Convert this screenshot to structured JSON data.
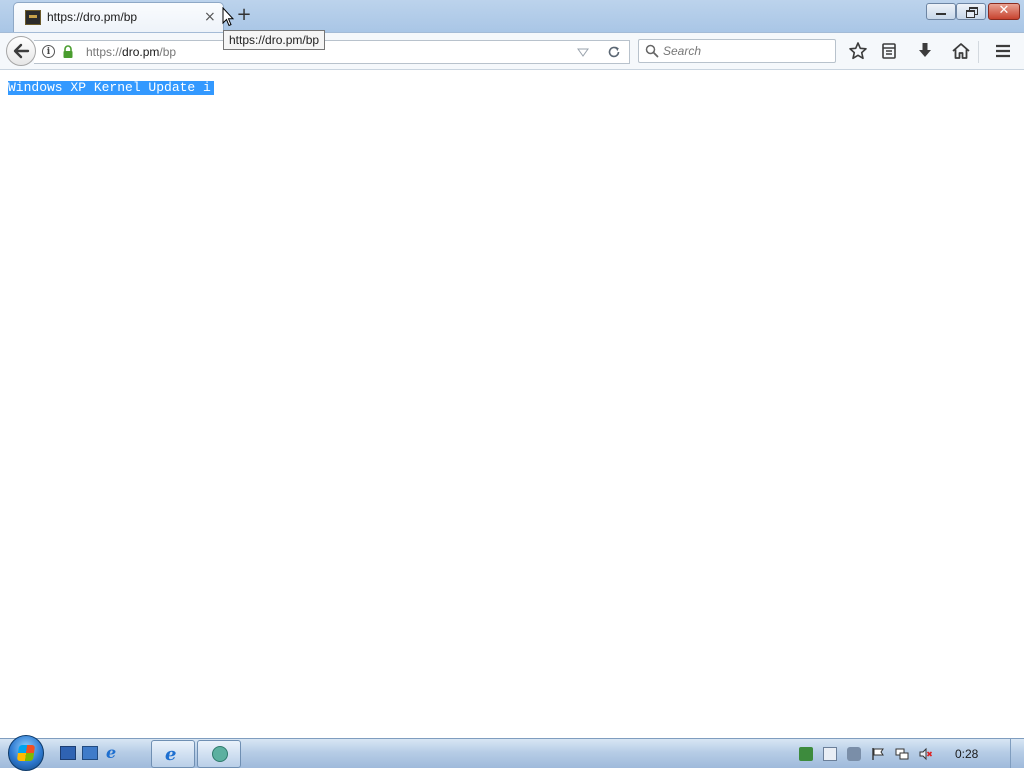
{
  "browser": {
    "tab": {
      "title": "https://dro.pm/bp",
      "close_glyph": "×"
    },
    "new_tab_glyph": "+",
    "tooltip": "https://dro.pm/bp",
    "url": {
      "scheme": "https://",
      "host": "dro.pm",
      "path": "/bp"
    },
    "search": {
      "placeholder": "Search"
    },
    "icons": [
      "back-icon",
      "info-icon",
      "lock-icon",
      "dropmarker-icon",
      "reload-icon",
      "search-icon",
      "bookmark-star-icon",
      "library-icon",
      "download-icon",
      "home-icon",
      "menu-icon"
    ]
  },
  "window_controls": {
    "close_glyph": "✕"
  },
  "page": {
    "text": "Windows XP Kernel Update i"
  },
  "taskbar": {
    "clock": "0:28"
  },
  "colors": {
    "selection": "#3399ff",
    "accent": "#2e7ad1"
  }
}
